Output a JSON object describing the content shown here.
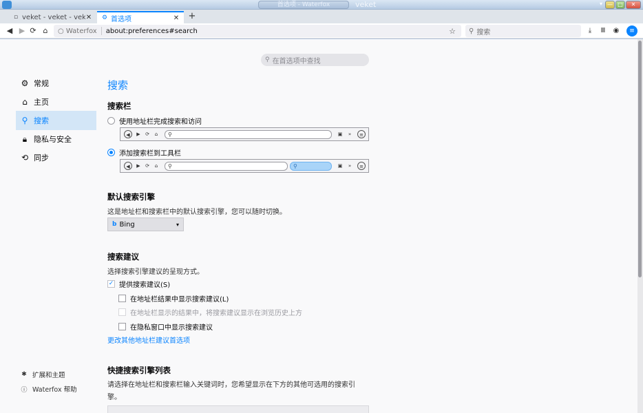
{
  "window": {
    "title": "首选项 - Waterfox",
    "app_name": "veket",
    "menu_glyph": "▾",
    "min_glyph": "—",
    "max_glyph": "□",
    "close_glyph": "✕"
  },
  "tabs": [
    {
      "label": "veket - veket - vekete",
      "close": "✕"
    },
    {
      "label": "首选项",
      "close": "✕"
    }
  ],
  "newtab_glyph": "+",
  "navbar": {
    "identity": "Waterfox",
    "url": "about:preferences#search",
    "search_placeholder": "搜索"
  },
  "find": {
    "placeholder": "在首选项中查找"
  },
  "sidebar": {
    "categories": [
      {
        "label": "常规",
        "icon": "gear-icon"
      },
      {
        "label": "主页",
        "icon": "home-icon"
      },
      {
        "label": "搜索",
        "icon": "search-icon",
        "selected": true
      },
      {
        "label": "隐私与安全",
        "icon": "lock-icon"
      },
      {
        "label": "同步",
        "icon": "sync-icon"
      }
    ],
    "footer": [
      {
        "label": "扩展和主题",
        "icon": "puzzle-icon"
      },
      {
        "label": "Waterfox 帮助",
        "icon": "help-icon"
      }
    ]
  },
  "search_pane": {
    "title": "搜索",
    "searchbar": {
      "heading": "搜索栏",
      "option_urlbar": "使用地址栏完成搜索和访问",
      "option_toolbar": "添加搜索栏到工具栏",
      "selected": "toolbar"
    },
    "default_engine": {
      "heading": "默认搜索引擎",
      "description": "这是地址栏和搜索栏中的默认搜索引擎，您可以随时切换。",
      "value": "Bing"
    },
    "suggestions": {
      "heading": "搜索建议",
      "description": "选择搜索引擎建议的呈现方式。",
      "provide": "提供搜索建议(S)",
      "provide_checked": true,
      "show_in_urlbar": "在地址栏结果中显示搜索建议(L)",
      "show_in_urlbar_checked": false,
      "above_history": "在地址栏显示的结果中，将搜索建议显示在浏览历史上方",
      "above_history_checked": false,
      "private": "在隐私窗口中显示搜索建议",
      "private_checked": false,
      "link": "更改其他地址栏建议首选项"
    },
    "one_click": {
      "heading": "快捷搜索引擎列表",
      "description_line1": "请选择在地址栏和搜索栏输入关键词时，您希望显示在下方的其他可选用的搜索引",
      "description_line2": "擎。"
    }
  },
  "colors": {
    "accent": "#0a84ff",
    "selected_bg": "#d3e6f7"
  }
}
